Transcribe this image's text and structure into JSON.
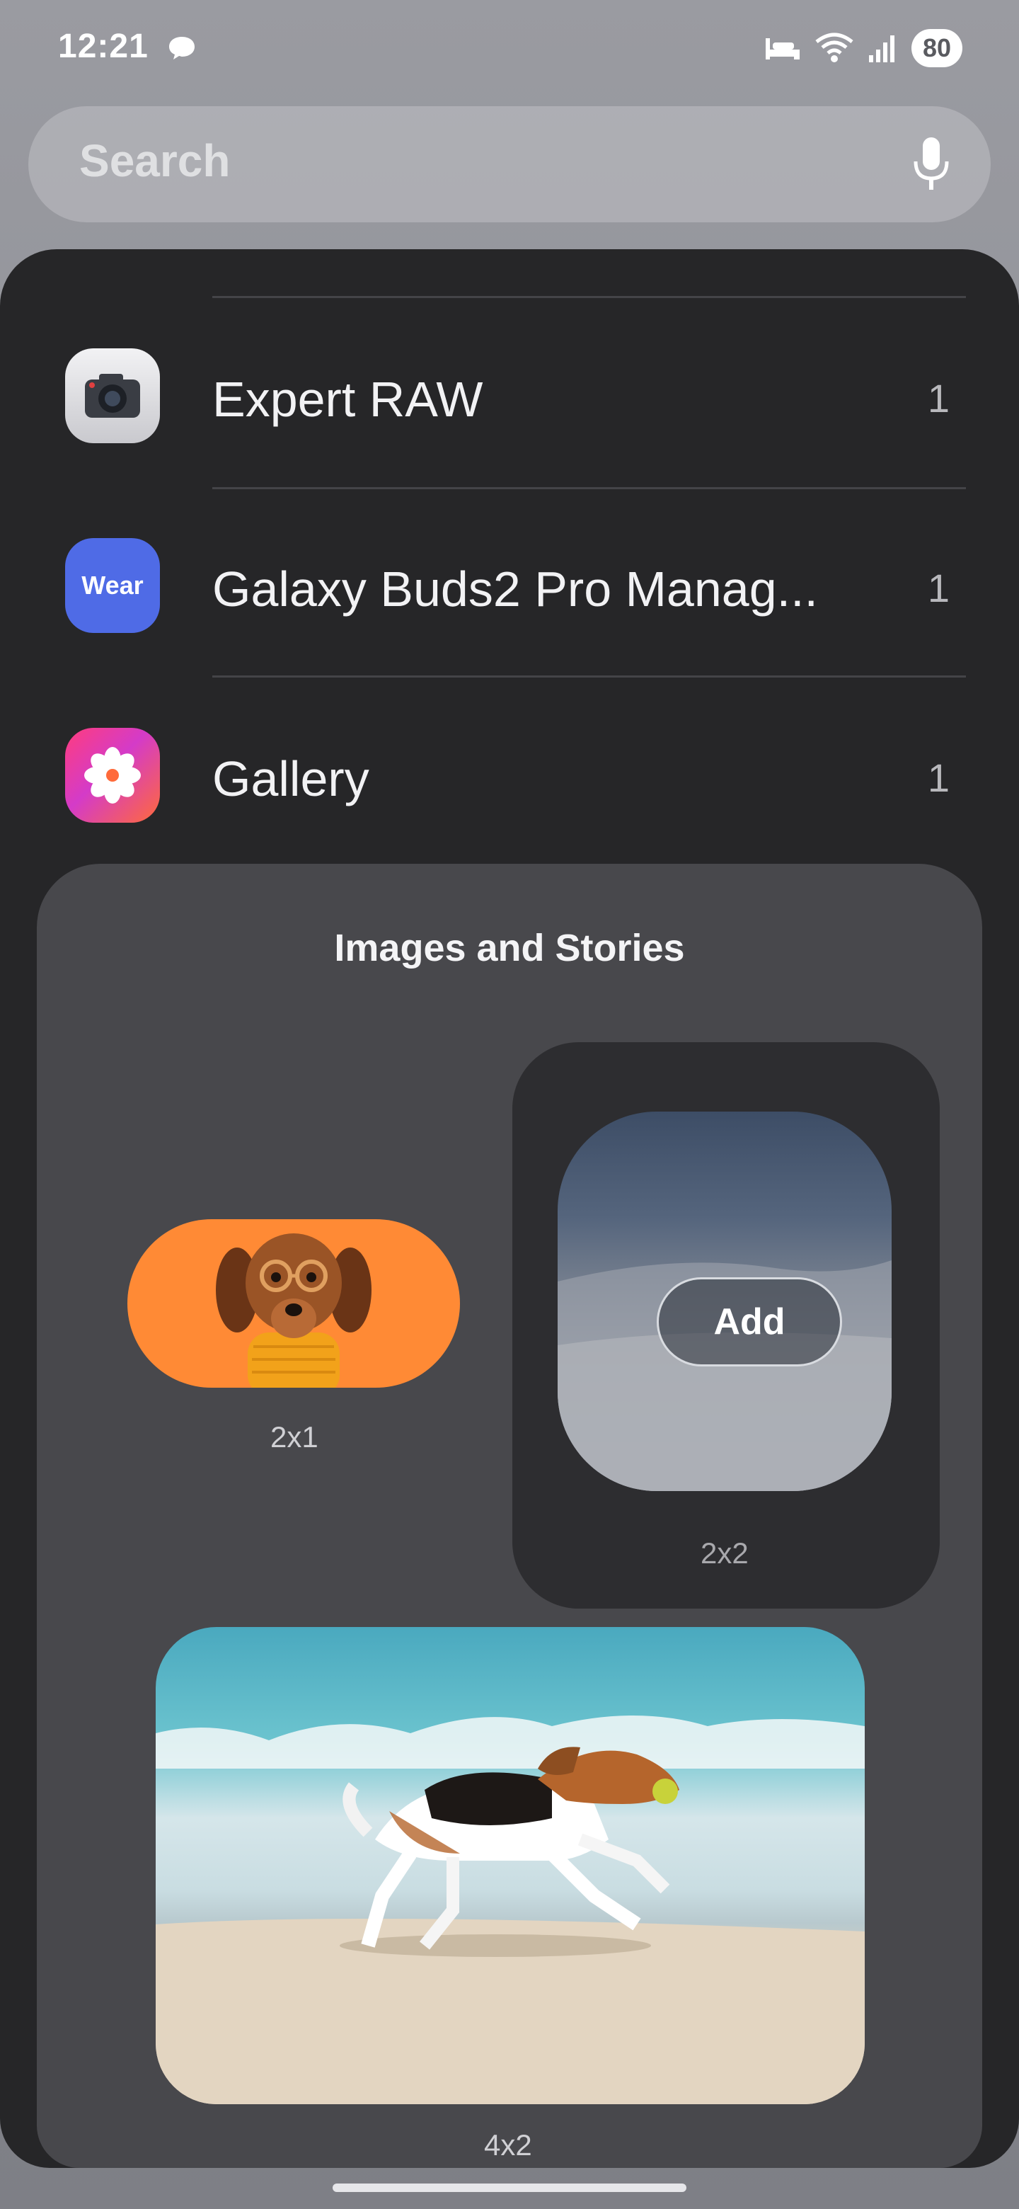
{
  "status_bar": {
    "time": "12:21",
    "battery": "80"
  },
  "search": {
    "placeholder": "Search"
  },
  "apps": [
    {
      "name": "Expert RAW",
      "count": "1",
      "icon": "camera-icon"
    },
    {
      "name": "Galaxy Buds2 Pro Manag...",
      "count": "1",
      "icon": "wear-icon",
      "icon_text": "Wear"
    },
    {
      "name": "Gallery",
      "count": "1",
      "icon": "gallery-flower-icon"
    }
  ],
  "widgets": {
    "title": "Images and Stories",
    "items": [
      {
        "size": "2x1"
      },
      {
        "size": "2x2",
        "button": "Add"
      },
      {
        "size": "4x2"
      }
    ]
  },
  "colors": {
    "panel": "#262628",
    "card": "#48484c",
    "accent_orange": "#ff8a35"
  }
}
